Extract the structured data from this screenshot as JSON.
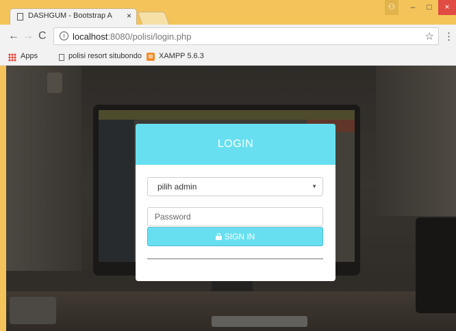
{
  "browser": {
    "tab": {
      "title": "DASHGUM - Bootstrap A",
      "close": "×"
    },
    "window_controls": {
      "user": "⚇",
      "minimize": "–",
      "maximize": "□",
      "close": "×"
    },
    "nav": {
      "back": "←",
      "forward": "→",
      "reload": "C"
    },
    "address": {
      "info_icon": "i",
      "host": "localhost",
      "rest": ":8080/polisi/login.php"
    },
    "star": "☆",
    "menu": "⋮"
  },
  "bookmarks": [
    {
      "label": "Apps",
      "icon": "apps-icon"
    },
    {
      "label": "polisi resort situbondo",
      "icon": "page-icon"
    },
    {
      "label": "XAMPP 5.6.3",
      "icon": "xampp-icon"
    }
  ],
  "login": {
    "title": "LOGIN",
    "select": {
      "value": "pilih admin",
      "arrow": "▼"
    },
    "password": {
      "placeholder": "Password"
    },
    "signin_label": "SIGN IN"
  },
  "colors": {
    "accent": "#68dff0",
    "chrome": "#f4c45a",
    "close": "#e04b43"
  }
}
